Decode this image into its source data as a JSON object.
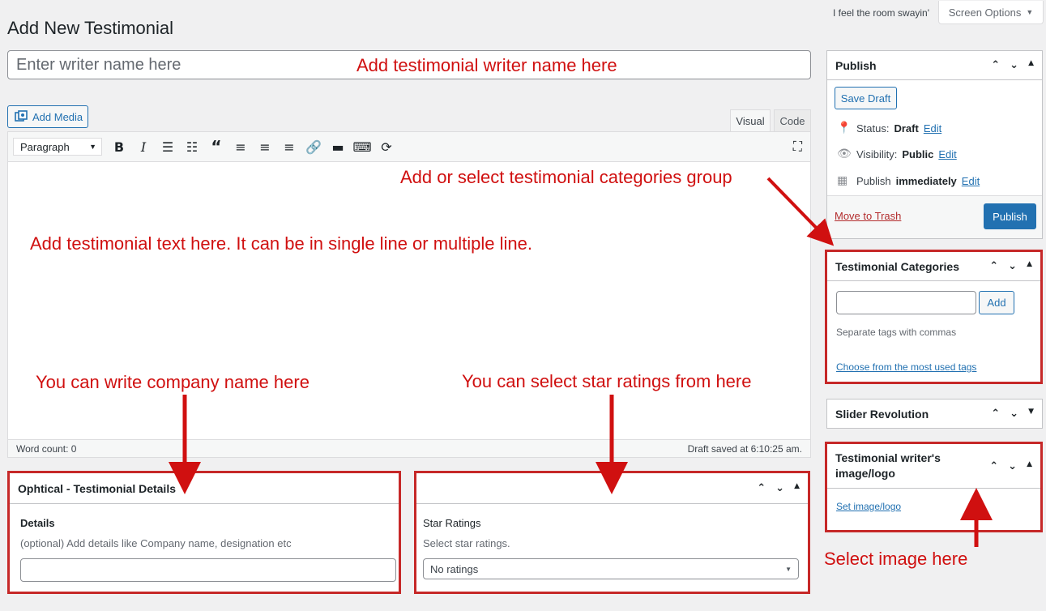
{
  "header": {
    "howdy": "I feel the room swayin'",
    "screen_options": "Screen Options",
    "page_title": "Add New Testimonial"
  },
  "title_field": {
    "placeholder": "Enter writer name here"
  },
  "editor": {
    "add_media": "Add Media",
    "tabs": [
      "Visual",
      "Code"
    ],
    "format_select": "Paragraph",
    "word_count": "Word count: 0",
    "draft_saved": "Draft saved at 6:10:25 am."
  },
  "details_box": {
    "title": "Ophtical - Testimonial Details",
    "label": "Details",
    "hint": "(optional) Add details like Company name, designation etc"
  },
  "ratings_box": {
    "label": "Star Ratings",
    "hint": "Select star ratings.",
    "selected": "No ratings"
  },
  "publish_box": {
    "title": "Publish",
    "save_draft": "Save Draft",
    "status_label": "Status:",
    "status_value": "Draft",
    "visibility_label": "Visibility:",
    "visibility_value": "Public",
    "publish_label": "Publish",
    "publish_value": "immediately",
    "edit": "Edit",
    "trash": "Move to Trash",
    "publish_button": "Publish"
  },
  "categories_box": {
    "title": "Testimonial Categories",
    "add": "Add",
    "hint": "Separate tags with commas",
    "choose": "Choose from the most used tags"
  },
  "slider_box": {
    "title": "Slider Revolution"
  },
  "image_box": {
    "title_line1": "Testimonial writer's",
    "title_line2": "image/logo",
    "link": "Set image/logo"
  },
  "annotations": {
    "writer_name": "Add testimonial writer name here",
    "categories": "Add or select testimonial categories group",
    "text": "Add testimonial text here. It can be in single line or multiple line.",
    "company": "You can write company name here",
    "stars": "You can select star ratings from here",
    "image": "Select image here"
  },
  "colors": {
    "accent": "#2271b1",
    "annotation": "#d01010",
    "frame": "#c62828"
  }
}
